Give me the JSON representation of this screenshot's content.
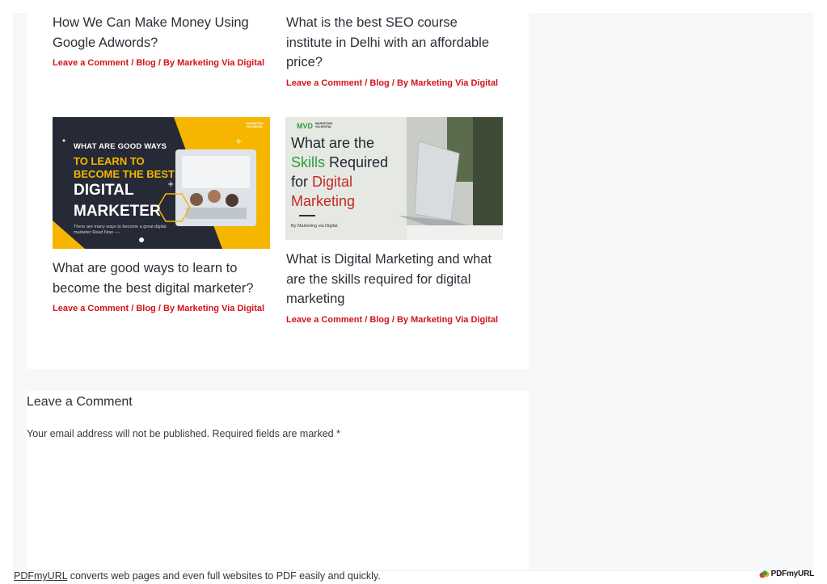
{
  "posts": [
    {
      "title": "How We Can Make Money Using Google Adwords?",
      "meta": {
        "comment": "Leave a Comment",
        "category": "Blog",
        "author": "By Marketing Via Digital",
        "sep": " / "
      }
    },
    {
      "title": "What is the best SEO course institute in Delhi with an affordable price?",
      "meta": {
        "comment": "Leave a Comment",
        "category": "Blog",
        "author": "By Marketing Via Digital",
        "sep": " / "
      }
    },
    {
      "title": "What are good ways to learn to become the best digital marketer?",
      "meta": {
        "comment": "Leave a Comment",
        "category": "Blog",
        "author": "By Marketing Via Digital",
        "sep": " / "
      },
      "thumbnail": {
        "line1": "WHAT ARE GOOD WAYS",
        "line2": "TO LEARN TO",
        "line3": "BECOME THE BEST",
        "line4": "DIGITAL",
        "line5": "MARKETER",
        "subtext": "There are many ways to become a great digital marketer Read Now ----",
        "logo_mark": "MVD",
        "logo_line1": "MARKETING",
        "logo_line2": "VIA DIGITAL",
        "colors": {
          "bg": "#262a36",
          "accent": "#f6b600"
        }
      }
    },
    {
      "title": "What is Digital Marketing and what are the skills required for digital marketing",
      "meta": {
        "comment": "Leave a Comment",
        "category": "Blog",
        "author": "By Marketing Via Digital",
        "sep": " / "
      },
      "thumbnail": {
        "line1": "What are the",
        "line2a": "Skills",
        "line2b": " Required",
        "line3a": "for ",
        "line3b": "Digital",
        "line4": "Marketing",
        "byline": "By Marketing via Digital",
        "logo_mark": "MVD",
        "logo_line1": "MARKETING",
        "logo_line2": "VIA DIGITAL",
        "colors": {
          "bg": "#e6e8e3",
          "green": "#2a9d3a",
          "red": "#c42a22"
        }
      }
    }
  ],
  "comments": {
    "title": "Leave a Comment",
    "note": "Your email address will not be published. Required fields are marked *"
  },
  "footer": {
    "link": "PDFmyURL",
    "text": " converts web pages and even full websites to PDF easily and quickly.",
    "logo": "PDFmyURL"
  },
  "colors": {
    "link_red": "#d2131a",
    "page_bg": "#f5f7f9"
  }
}
